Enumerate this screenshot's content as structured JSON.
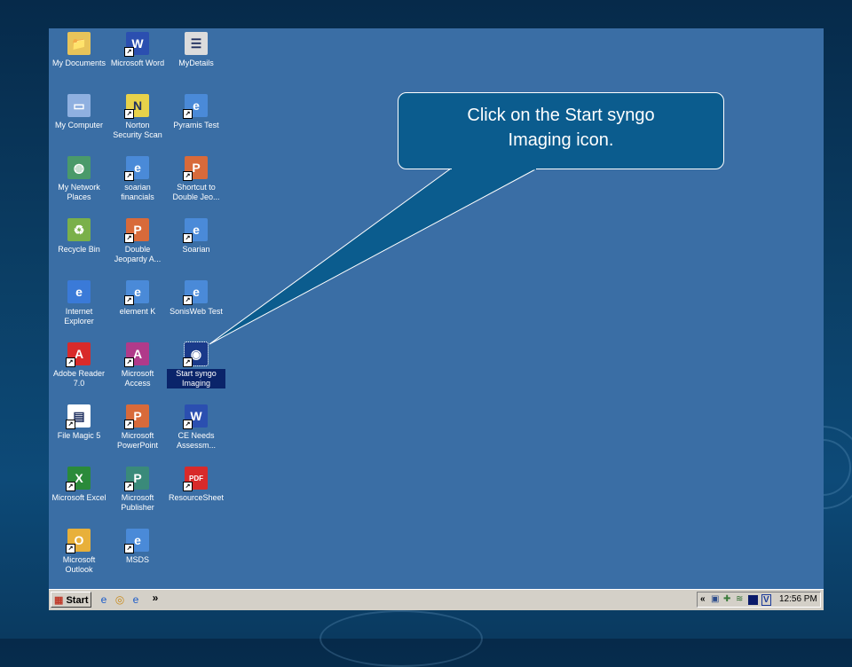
{
  "callout": {
    "line1": "Click on the Start syngo",
    "line2": "Imaging icon."
  },
  "desktop_icons": [
    {
      "label1": "My Documents",
      "label2": "",
      "icon": "folder-icon",
      "color": "#e8c45a",
      "selected": false
    },
    {
      "label1": "Microsoft Word",
      "label2": "",
      "icon": "word-icon",
      "color": "#2b4fb0",
      "selected": false
    },
    {
      "label1": "MyDetails",
      "label2": "",
      "icon": "details-icon",
      "color": "#dcdcdc",
      "selected": false
    },
    {
      "label1": "My Computer",
      "label2": "",
      "icon": "computer-icon",
      "color": "#8fb0e0",
      "selected": false
    },
    {
      "label1": "Norton",
      "label2": "Security Scan",
      "icon": "norton-icon",
      "color": "#e8d24a",
      "selected": false
    },
    {
      "label1": "Pyramis Test",
      "label2": "",
      "icon": "ie-shortcut-icon",
      "color": "#4a8ad8",
      "selected": false
    },
    {
      "label1": "My Network",
      "label2": "Places",
      "icon": "network-icon",
      "color": "#4a9a6a",
      "selected": false
    },
    {
      "label1": "soarian",
      "label2": "financials",
      "icon": "ie-shortcut-icon",
      "color": "#4a8ad8",
      "selected": false
    },
    {
      "label1": "Shortcut to",
      "label2": "Double Jeo...",
      "icon": "powerpoint-icon",
      "color": "#d86a3a",
      "selected": false
    },
    {
      "label1": "Recycle Bin",
      "label2": "",
      "icon": "recycle-bin-icon",
      "color": "#7ab04a",
      "selected": false
    },
    {
      "label1": "Double",
      "label2": "Jeopardy A...",
      "icon": "powerpoint-icon",
      "color": "#d86a3a",
      "selected": false
    },
    {
      "label1": "Soarian",
      "label2": "",
      "icon": "ie-shortcut-icon",
      "color": "#4a8ad8",
      "selected": false
    },
    {
      "label1": "Internet",
      "label2": "Explorer",
      "icon": "internet-explorer-icon",
      "color": "#3a7ad8",
      "selected": false
    },
    {
      "label1": "element K",
      "label2": "",
      "icon": "ie-shortcut-icon",
      "color": "#4a8ad8",
      "selected": false
    },
    {
      "label1": "SonisWeb Test",
      "label2": "",
      "icon": "ie-shortcut-icon",
      "color": "#4a8ad8",
      "selected": false
    },
    {
      "label1": "Adobe Reader",
      "label2": "7.0",
      "icon": "adobe-reader-icon",
      "color": "#d82a2a",
      "selected": false
    },
    {
      "label1": "Microsoft",
      "label2": "Access",
      "icon": "access-icon",
      "color": "#b03a8a",
      "selected": false
    },
    {
      "label1": "Start syngo",
      "label2": "Imaging",
      "icon": "syngo-imaging-icon",
      "color": "#1a3a8a",
      "selected": true
    },
    {
      "label1": "File Magic 5",
      "label2": "",
      "icon": "file-magic-icon",
      "color": "#ffffff",
      "selected": false
    },
    {
      "label1": "Microsoft",
      "label2": "PowerPoint",
      "icon": "powerpoint-icon",
      "color": "#d86a3a",
      "selected": false
    },
    {
      "label1": "CE Needs",
      "label2": "Assessm...",
      "icon": "word-doc-icon",
      "color": "#2b4fb0",
      "selected": false
    },
    {
      "label1": "Microsoft Excel",
      "label2": "",
      "icon": "excel-icon",
      "color": "#2a8a3a",
      "selected": false
    },
    {
      "label1": "Microsoft",
      "label2": "Publisher",
      "icon": "publisher-icon",
      "color": "#3a8a7a",
      "selected": false
    },
    {
      "label1": "ResourceSheet",
      "label2": "",
      "icon": "pdf-icon",
      "color": "#d82a2a",
      "selected": false
    },
    {
      "label1": "Microsoft",
      "label2": "Outlook",
      "icon": "outlook-icon",
      "color": "#e8b03a",
      "selected": false
    },
    {
      "label1": "MSDS",
      "label2": "",
      "icon": "ie-shortcut-icon",
      "color": "#4a8ad8",
      "selected": false
    }
  ],
  "taskbar": {
    "start_label": "Start",
    "quick_launch": [
      "ie-icon",
      "outlook-icon",
      "ie-shortcut-icon"
    ],
    "chevron": "»",
    "tray_chevron": "«",
    "tray_badge": "V",
    "clock": "12:56 PM"
  }
}
